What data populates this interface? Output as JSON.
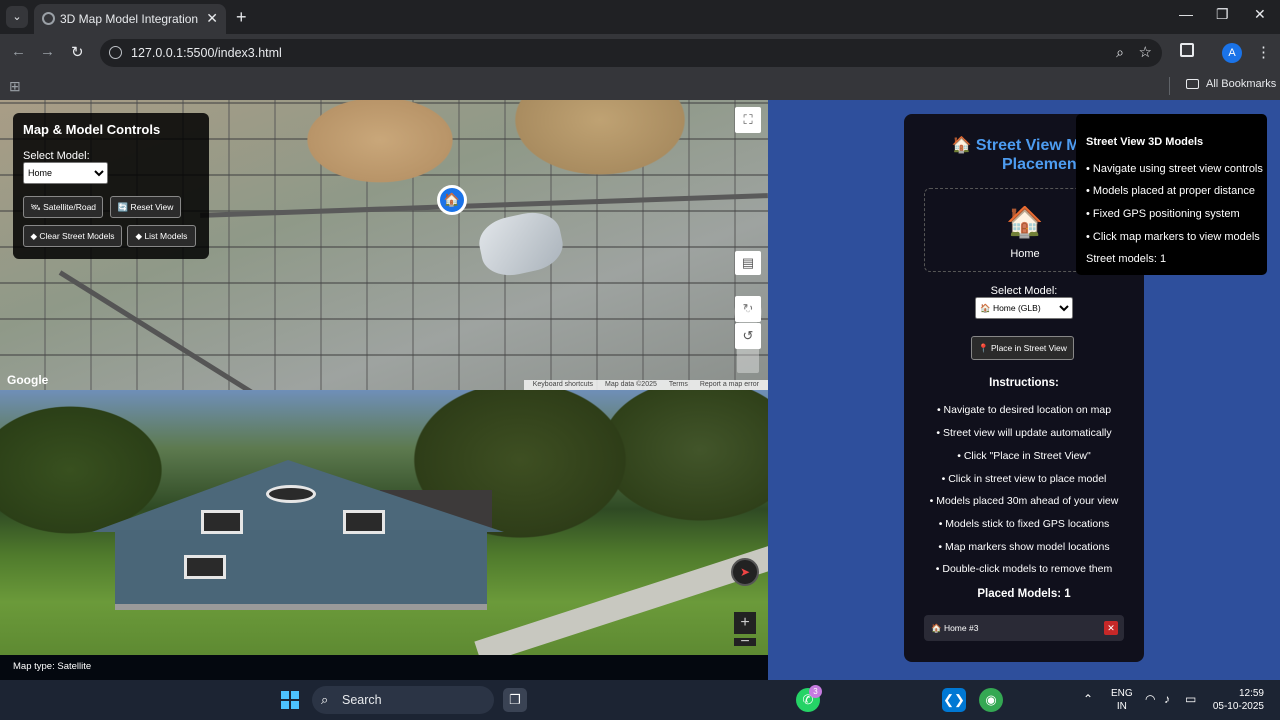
{
  "browser": {
    "tab_title": "3D Map Model Integration",
    "url": "127.0.0.1:5500/index3.html",
    "profile_initial": "A",
    "bookmarks_label": "All Bookmarks"
  },
  "controls": {
    "title": "Map & Model Controls",
    "select_label": "Select Model:",
    "selected_model": "Home",
    "buttons": {
      "satellite": "🛰 Satellite/Road",
      "reset": "🔄 Reset View",
      "clear": "◆ Clear Street Models",
      "list": "◆ List Models"
    }
  },
  "map": {
    "google_logo": "Google",
    "attribution": [
      "Keyboard shortcuts",
      "Map data ©2025",
      "Terms",
      "Report a map error"
    ],
    "marker_icon": "home-icon"
  },
  "status": {
    "map_type": "Map type: Satellite"
  },
  "placement": {
    "title": "Street View Model Placement",
    "preview_label": "Home",
    "select_label": "Select Model:",
    "selected_model": "🏠 Home (GLB)",
    "place_button": "📍 Place in Street View",
    "instructions_title": "Instructions:",
    "instructions": [
      "• Navigate to desired location on map",
      "• Street view will update automatically",
      "• Click \"Place in Street View\"",
      "• Click in street view to place model",
      "• Models placed 30m ahead of your view",
      "• Models stick to fixed GPS locations",
      "• Map markers show model locations",
      "• Double-click models to remove them"
    ],
    "placed_title": "Placed Models: 1",
    "placed_items": [
      "🏠 Home #3"
    ]
  },
  "street_info": {
    "title": "Street View 3D Models",
    "lines": [
      "• Navigate using street view controls",
      "• Models placed at proper distance",
      "• Fixed GPS positioning system",
      "• Click map markers to view models"
    ],
    "count": "Street models: 1"
  },
  "taskbar": {
    "search_label": "Search",
    "whatsapp_badge": "3",
    "lang_line1": "ENG",
    "lang_line2": "IN",
    "time": "12:59",
    "date": "05-10-2025"
  }
}
